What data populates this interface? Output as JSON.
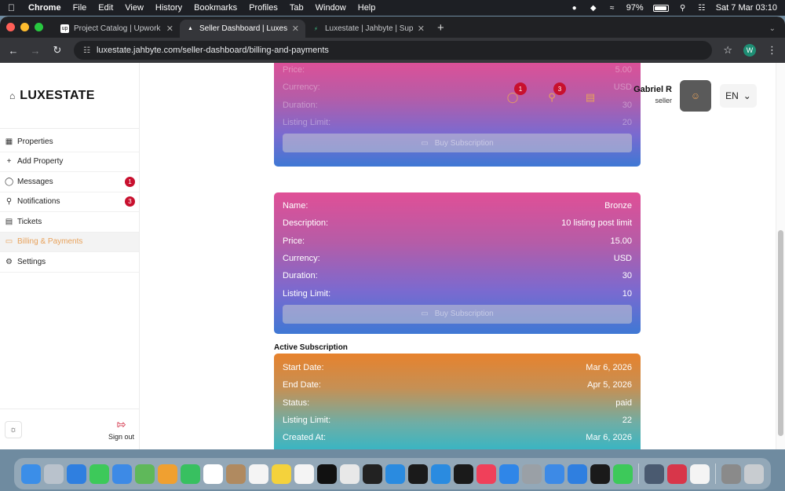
{
  "menubar": {
    "app": "Chrome",
    "menus": [
      "File",
      "Edit",
      "View",
      "History",
      "Bookmarks",
      "Profiles",
      "Tab",
      "Window",
      "Help"
    ],
    "battery": "97%",
    "datetime": "Sat 7 Mar  03:10"
  },
  "browser": {
    "tabs": [
      {
        "title": "Project Catalog | Upwork",
        "favicon": "up"
      },
      {
        "title": "Seller Dashboard | Luxestate",
        "favicon": "▲"
      },
      {
        "title": "Luxestate | Jahbyte | Supabase",
        "favicon": "⚡"
      }
    ],
    "url": "luxestate.jahbyte.com/seller-dashboard/billing-and-payments",
    "profile_initial": "W"
  },
  "sidebar": {
    "brand": "LUXESTATE",
    "items": [
      {
        "label": "Properties",
        "icon": "building-icon"
      },
      {
        "label": "Add Property",
        "icon": "plus-icon"
      },
      {
        "label": "Messages",
        "icon": "chat-icon",
        "badge": "1"
      },
      {
        "label": "Notifications",
        "icon": "bell-icon",
        "badge": "3"
      },
      {
        "label": "Tickets",
        "icon": "ticket-icon"
      },
      {
        "label": "Billing & Payments",
        "icon": "card-icon"
      },
      {
        "label": "Settings",
        "icon": "gear-icon"
      }
    ],
    "signout": "Sign out"
  },
  "header": {
    "messages_badge": "1",
    "notifications_badge": "3",
    "user_name": "Gabriel R",
    "user_role": "seller",
    "language": "EN"
  },
  "top_card": {
    "rows": [
      {
        "label": "Price:",
        "value": "5.00"
      },
      {
        "label": "Currency:",
        "value": "USD"
      },
      {
        "label": "Duration:",
        "value": "30"
      },
      {
        "label": "Listing Limit:",
        "value": "20"
      }
    ],
    "button": "Buy Subscription"
  },
  "bronze_card": {
    "rows": [
      {
        "label": "Name:",
        "value": "Bronze"
      },
      {
        "label": "Description:",
        "value": "10 listing post limit"
      },
      {
        "label": "Price:",
        "value": "15.00"
      },
      {
        "label": "Currency:",
        "value": "USD"
      },
      {
        "label": "Duration:",
        "value": "30"
      },
      {
        "label": "Listing Limit:",
        "value": "10"
      }
    ],
    "button": "Buy Subscription"
  },
  "active_subscription": {
    "title": "Active Subscription",
    "rows": [
      {
        "label": "Start Date:",
        "value": "Mar 6, 2026"
      },
      {
        "label": "End Date:",
        "value": "Apr 5, 2026"
      },
      {
        "label": "Status:",
        "value": "paid"
      },
      {
        "label": "Listing Limit:",
        "value": "22"
      },
      {
        "label": "Created At:",
        "value": "Mar 6, 2026"
      }
    ]
  },
  "dock": {
    "apps": [
      {
        "name": "finder",
        "color": "#3b8ee8"
      },
      {
        "name": "launchpad",
        "color": "#b9c2cc"
      },
      {
        "name": "safari",
        "color": "#2f7fe0"
      },
      {
        "name": "messages",
        "color": "#3dc95a"
      },
      {
        "name": "mail",
        "color": "#3d8ae6"
      },
      {
        "name": "maps",
        "color": "#5fb85a"
      },
      {
        "name": "photos",
        "color": "#f0a030"
      },
      {
        "name": "facetime",
        "color": "#38c060"
      },
      {
        "name": "calendar",
        "color": "#ffffff"
      },
      {
        "name": "contacts",
        "color": "#b08a60"
      },
      {
        "name": "reminders",
        "color": "#f4f4f4"
      },
      {
        "name": "notes",
        "color": "#f4d23c"
      },
      {
        "name": "freeform",
        "color": "#f4f4f4"
      },
      {
        "name": "tv",
        "color": "#111111"
      },
      {
        "name": "chrome",
        "color": "#e8e8e8"
      },
      {
        "name": "cursor",
        "color": "#222222"
      },
      {
        "name": "vscode",
        "color": "#2a8be0"
      },
      {
        "name": "terminal",
        "color": "#1a1a1a"
      },
      {
        "name": "docker",
        "color": "#2a8be0"
      },
      {
        "name": "figma",
        "color": "#1a1a1a"
      },
      {
        "name": "music",
        "color": "#f0405a"
      },
      {
        "name": "app-store",
        "color": "#2f86e8"
      },
      {
        "name": "system-settings",
        "color": "#9aa0a6"
      },
      {
        "name": "preview",
        "color": "#3d8ae6"
      },
      {
        "name": "files",
        "color": "#2f7fe0"
      },
      {
        "name": "activity",
        "color": "#1a1a1a"
      },
      {
        "name": "whatsapp",
        "color": "#3dc95a"
      },
      {
        "name": "disk",
        "color": "#4a5a70"
      },
      {
        "name": "archive",
        "color": "#d8364a"
      },
      {
        "name": "textedit",
        "color": "#f4f4f4"
      },
      {
        "name": "phone-preview",
        "color": "#8a8a8a"
      },
      {
        "name": "trash",
        "color": "#c8ccd0"
      }
    ]
  }
}
